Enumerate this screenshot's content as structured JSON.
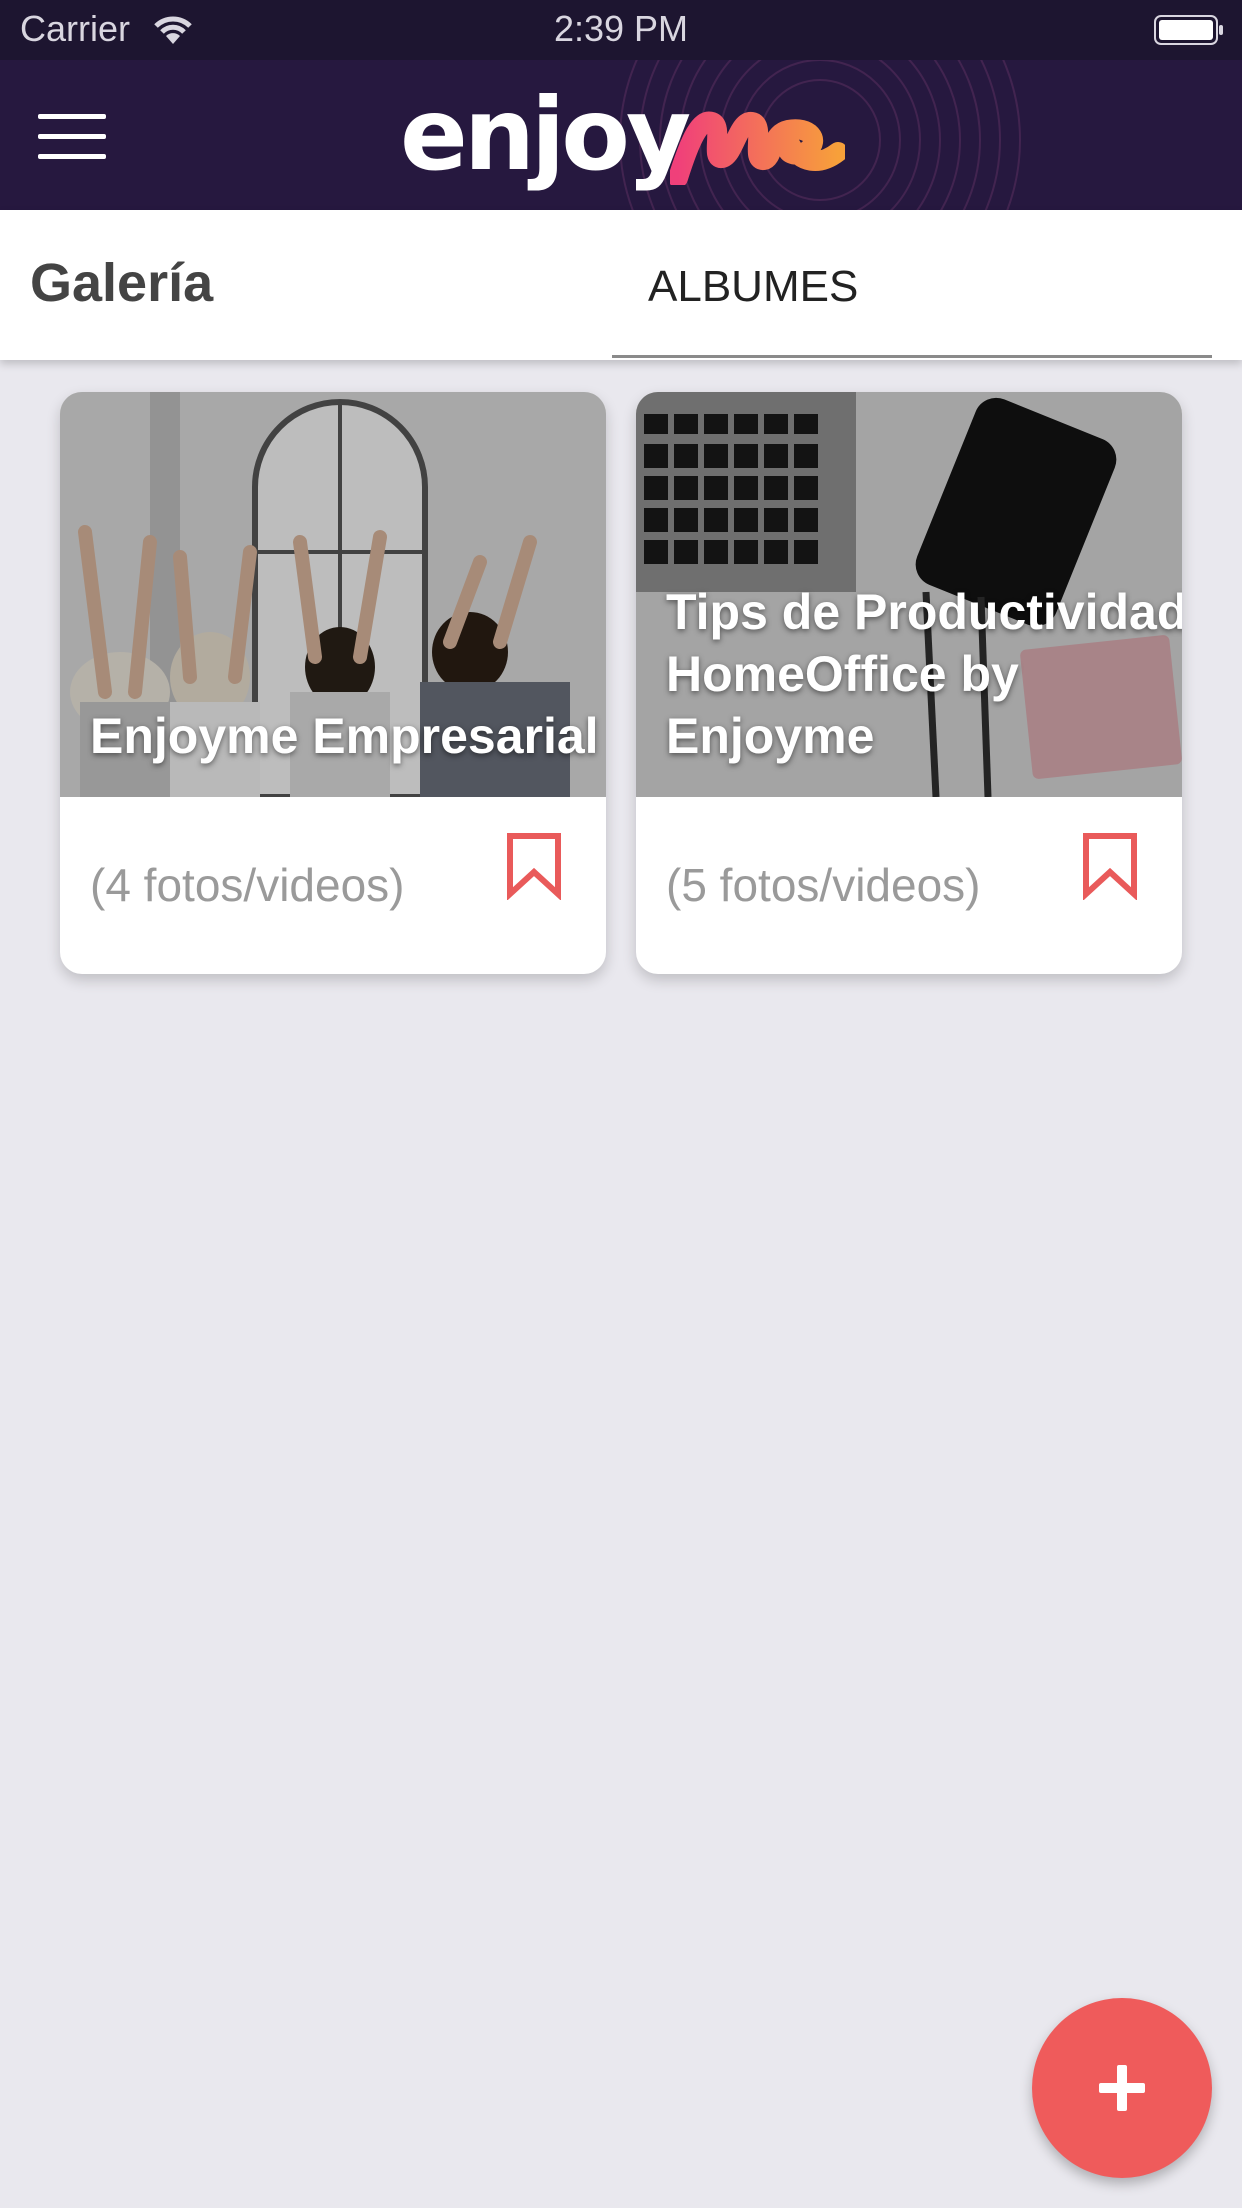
{
  "status_bar": {
    "carrier": "Carrier",
    "time": "2:39 PM",
    "icons": [
      "wifi-icon",
      "battery-icon"
    ]
  },
  "header": {
    "menu_icon": "hamburger-menu-icon",
    "logo_text": "enjoy",
    "logo_accent_text": "me",
    "colors": {
      "background": "#26183f",
      "logo_gradient": [
        "#f0407a",
        "#f7a03a"
      ]
    }
  },
  "tabbar": {
    "title": "Galería",
    "tabs": [
      {
        "label": "ALBUMES",
        "selected": true
      }
    ]
  },
  "albums": [
    {
      "title": "Enjoyme Empresarial",
      "count": "(4 fotos/videos)",
      "icon": "bookmark-icon"
    },
    {
      "title_lines": [
        "Tips de Productividad",
        "HomeOffice by",
        "Enjoyme"
      ],
      "count": "(5 fotos/videos)",
      "icon": "bookmark-icon"
    }
  ],
  "fab": {
    "icon": "plus-icon",
    "color": "#ef5b5b"
  },
  "colors": {
    "page_background": "#e9e8ee",
    "accent": "#ef5b5b"
  }
}
